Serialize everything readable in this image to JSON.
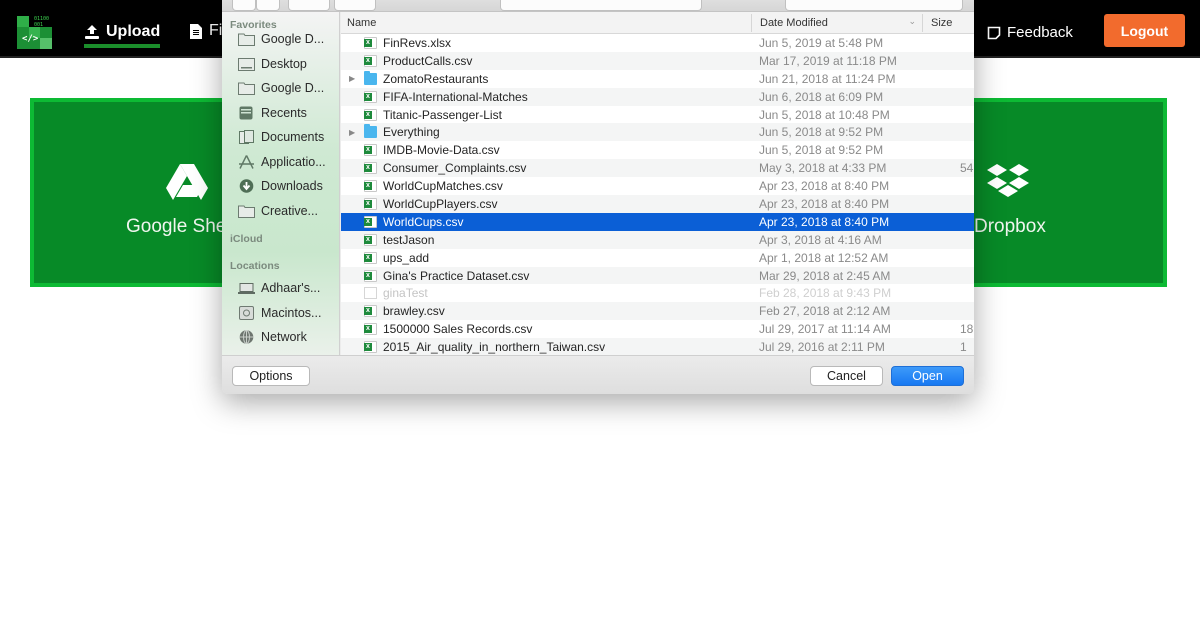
{
  "header": {
    "logo_bits": "01100\n001",
    "logo_code": "</>",
    "nav": {
      "upload": "Upload",
      "files": "Fi",
      "feedback": "Feedback"
    },
    "logout": "Logout",
    "colors": {
      "accent": "#f26b2d",
      "active_underline": "#1b8d2b"
    }
  },
  "sources": {
    "left_label": "Google She",
    "right_label": "Dropbox",
    "panel_color": "#078a27"
  },
  "dialog": {
    "sidebar": {
      "sections": {
        "favorites": "Favorites",
        "icloud": "iCloud",
        "locations": "Locations"
      },
      "favorites": [
        {
          "label": "Google D...",
          "icon": "folder-icon"
        },
        {
          "label": "Desktop",
          "icon": "desktop-icon"
        },
        {
          "label": "Google D...",
          "icon": "folder-icon"
        },
        {
          "label": "Recents",
          "icon": "recents-icon"
        },
        {
          "label": "Documents",
          "icon": "documents-icon"
        },
        {
          "label": "Applicatio...",
          "icon": "applications-icon"
        },
        {
          "label": "Downloads",
          "icon": "downloads-icon"
        },
        {
          "label": "Creative...",
          "icon": "folder-icon"
        }
      ],
      "locations": [
        {
          "label": "Adhaar's...",
          "icon": "laptop-icon"
        },
        {
          "label": "Macintos...",
          "icon": "hard-drive-icon"
        },
        {
          "label": "Network",
          "icon": "network-icon"
        }
      ]
    },
    "columns": {
      "name": "Name",
      "date": "Date Modified",
      "size": "Size"
    },
    "files": [
      {
        "name": "FinRevs.xlsx",
        "date": "Jun 5, 2019 at 5:48 PM",
        "size": "",
        "type": "spreadsheet"
      },
      {
        "name": "ProductCalls.csv",
        "date": "Mar 17, 2019 at 11:18 PM",
        "size": "",
        "type": "spreadsheet"
      },
      {
        "name": "ZomatoRestaurants",
        "date": "Jun 21, 2018 at 11:24 PM",
        "size": "",
        "type": "folder"
      },
      {
        "name": "FIFA-International-Matches",
        "date": "Jun 6, 2018 at 6:09 PM",
        "size": "",
        "type": "spreadsheet"
      },
      {
        "name": "Titanic-Passenger-List",
        "date": "Jun 5, 2018 at 10:48 PM",
        "size": "",
        "type": "spreadsheet"
      },
      {
        "name": "Everything",
        "date": "Jun 5, 2018 at 9:52 PM",
        "size": "",
        "type": "folder"
      },
      {
        "name": "IMDB-Movie-Data.csv",
        "date": "Jun 5, 2018 at 9:52 PM",
        "size": "",
        "type": "spreadsheet"
      },
      {
        "name": "Consumer_Complaints.csv",
        "date": "May 3, 2018 at 4:33 PM",
        "size": "54",
        "type": "spreadsheet"
      },
      {
        "name": "WorldCupMatches.csv",
        "date": "Apr 23, 2018 at 8:40 PM",
        "size": "",
        "type": "spreadsheet"
      },
      {
        "name": "WorldCupPlayers.csv",
        "date": "Apr 23, 2018 at 8:40 PM",
        "size": "",
        "type": "spreadsheet"
      },
      {
        "name": "WorldCups.csv",
        "date": "Apr 23, 2018 at 8:40 PM",
        "size": "",
        "type": "spreadsheet",
        "selected": true
      },
      {
        "name": "testJason",
        "date": "Apr 3, 2018 at 4:16 AM",
        "size": "",
        "type": "spreadsheet"
      },
      {
        "name": "ups_add",
        "date": "Apr 1, 2018 at 12:52 AM",
        "size": "",
        "type": "spreadsheet"
      },
      {
        "name": "Gina's Practice Dataset.csv",
        "date": "Mar 29, 2018 at 2:45 AM",
        "size": "",
        "type": "spreadsheet"
      },
      {
        "name": "ginaTest",
        "date": "Feb 28, 2018 at 9:43 PM",
        "size": "",
        "type": "document",
        "dimmed": true
      },
      {
        "name": "brawley.csv",
        "date": "Feb 27, 2018 at 2:12 AM",
        "size": "",
        "type": "spreadsheet"
      },
      {
        "name": "1500000 Sales Records.csv",
        "date": "Jul 29, 2017 at 11:14 AM",
        "size": "18",
        "type": "spreadsheet"
      },
      {
        "name": "2015_Air_quality_in_northern_Taiwan.csv",
        "date": "Jul 29, 2016 at 2:11 PM",
        "size": "1",
        "type": "spreadsheet"
      }
    ],
    "buttons": {
      "options": "Options",
      "cancel": "Cancel",
      "open": "Open"
    },
    "colors": {
      "selection": "#0b5fd6",
      "primary_button": "#1778f2"
    }
  }
}
